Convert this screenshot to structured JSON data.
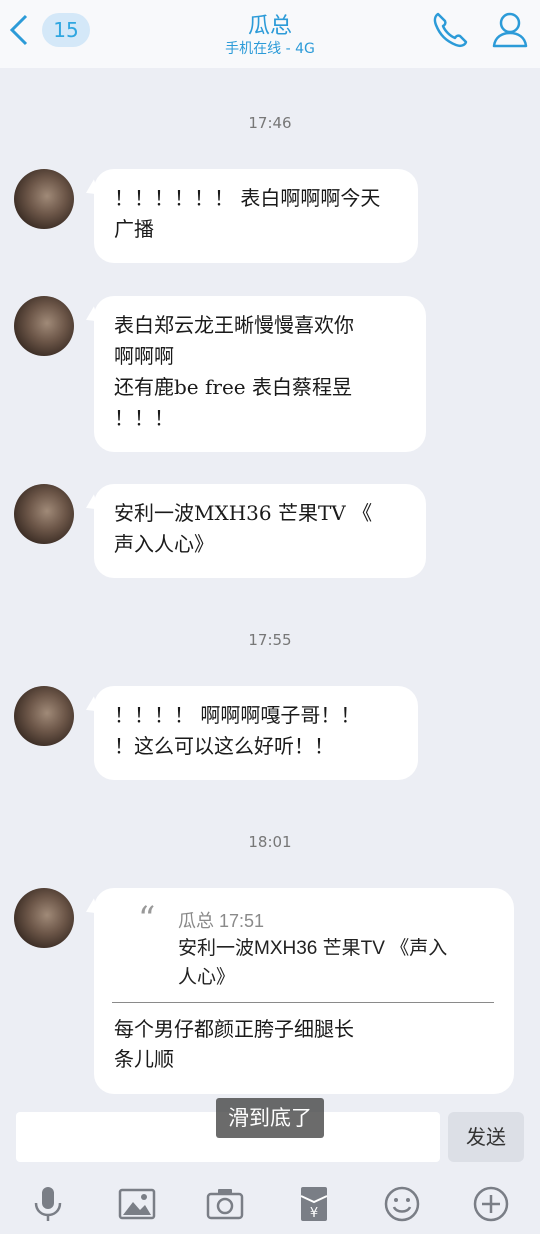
{
  "header": {
    "unread_count": "15",
    "contact_name": "瓜总",
    "status": "手机在线 - 4G",
    "icons": {
      "back": "back-chevron-icon",
      "call": "phone-icon",
      "profile": "person-icon"
    }
  },
  "messages": {
    "time1": "17:46",
    "m1": [
      "！！！！！！ 表白啊啊啊今天",
      "广播"
    ],
    "m2": [
      "表白郑云龙王晰慢慢喜欢你",
      "啊啊啊",
      "还有鹿be free  表白蔡程昱",
      "！！！"
    ],
    "m3": [
      "安利一波MXH36 芒果TV 《",
      "声入人心》"
    ],
    "time2": "17:55",
    "m4": [
      "！！！！ 啊啊啊嘎子哥！！",
      "！这么可以这么好听！！"
    ],
    "time3": "18:01",
    "m5": {
      "quote_mark": "“",
      "quote_meta": "瓜总 17:51",
      "quote_text": [
        "安利一波MXH36 芒果TV 《声入",
        "人心》"
      ],
      "reply": [
        "每个男仔都颜正胯子细腿长",
        "条儿顺"
      ]
    }
  },
  "toast": "滑到底了",
  "input": {
    "placeholder": "",
    "send_label": "发送"
  },
  "toolbar": [
    "microphone-icon",
    "image-icon",
    "camera-icon",
    "red-packet-icon",
    "emoji-icon",
    "plus-icon"
  ],
  "colors": {
    "accent": "#2c9bd8",
    "background": "#eceef4",
    "bubble": "#ffffff"
  }
}
